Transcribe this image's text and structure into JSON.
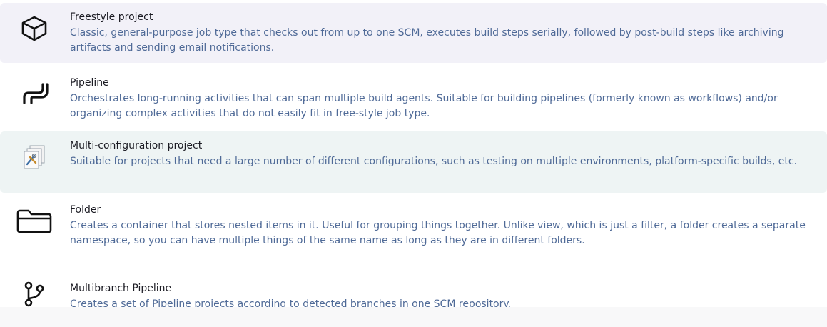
{
  "items": [
    {
      "title": "Freestyle project",
      "description": "Classic, general-purpose job type that checks out from up to one SCM, executes build steps serially, followed by post-build steps like archiving artifacts and sending email notifications.",
      "icon": "freestyle-cube-icon"
    },
    {
      "title": "Pipeline",
      "description": "Orchestrates long-running activities that can span multiple build agents. Suitable for building pipelines (formerly known as workflows) and/or organizing complex activities that do not easily fit in free-style job type.",
      "icon": "pipeline-icon"
    },
    {
      "title": "Multi-configuration project",
      "description": "Suitable for projects that need a large number of different configurations, such as testing on multiple environments, platform-specific builds, etc.",
      "icon": "multi-config-icon"
    },
    {
      "title": "Folder",
      "description": "Creates a container that stores nested items in it. Useful for grouping things together. Unlike view, which is just a filter, a folder creates a separate namespace, so you can have multiple things of the same name as long as they are in different folders.",
      "icon": "folder-icon"
    },
    {
      "title": "Multibranch Pipeline",
      "description": "Creates a set of Pipeline projects according to detected branches in one SCM repository.",
      "icon": "branch-icon"
    }
  ],
  "colors": {
    "title": "#1b1b23",
    "description": "#4f6a97",
    "highlight_purple": "#f2f1f8",
    "highlight_teal": "#eef4f4"
  }
}
